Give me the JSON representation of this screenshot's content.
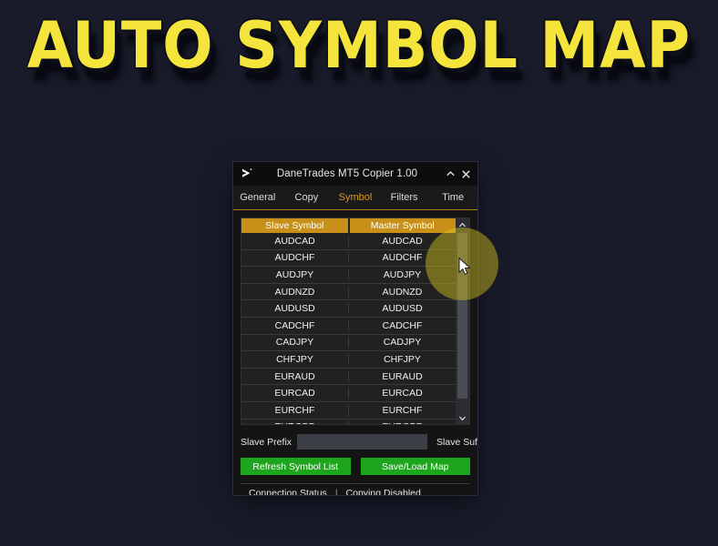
{
  "poster": {
    "headline": "AUTO SYMBOL MAP",
    "background_color": "#191b2a",
    "headline_color": "#f4e43c"
  },
  "window": {
    "title": "DaneTrades MT5 Copier 1.00",
    "app_icon": "chevron-play-icon",
    "minimize_label": "^",
    "close_label": "X",
    "accent_color": "#c89018",
    "tabs": [
      {
        "label": "General",
        "active": false
      },
      {
        "label": "Copy",
        "active": false
      },
      {
        "label": "Symbol",
        "active": true
      },
      {
        "label": "Filters",
        "active": false
      },
      {
        "label": "Time",
        "active": false
      }
    ],
    "symbol_table": {
      "columns": [
        "Slave Symbol",
        "Master Symbol"
      ],
      "rows": [
        [
          "AUDCAD",
          "AUDCAD"
        ],
        [
          "AUDCHF",
          "AUDCHF"
        ],
        [
          "AUDJPY",
          "AUDJPY"
        ],
        [
          "AUDNZD",
          "AUDNZD"
        ],
        [
          "AUDUSD",
          "AUDUSD"
        ],
        [
          "CADCHF",
          "CADCHF"
        ],
        [
          "CADJPY",
          "CADJPY"
        ],
        [
          "CHFJPY",
          "CHFJPY"
        ],
        [
          "EURAUD",
          "EURAUD"
        ],
        [
          "EURCAD",
          "EURCAD"
        ],
        [
          "EURCHF",
          "EURCHF"
        ],
        [
          "EURGBP",
          "EURGBP"
        ]
      ],
      "scroll_up_icon": "chevron-up-icon",
      "scroll_down_icon": "chevron-down-icon"
    },
    "fields": {
      "prefix_label": "Slave Prefix",
      "prefix_value": "",
      "prefix_placeholder": "",
      "suffix_label": "Slave Suffix",
      "suffix_value": "",
      "suffix_placeholder": ""
    },
    "buttons": {
      "refresh_label": "Refresh Symbol List",
      "save_load_label": "Save/Load Map",
      "color": "#1da51d"
    },
    "status": {
      "connection_label": "Connection Status",
      "separator": "|",
      "copying_label": "Copying Disabled"
    }
  }
}
